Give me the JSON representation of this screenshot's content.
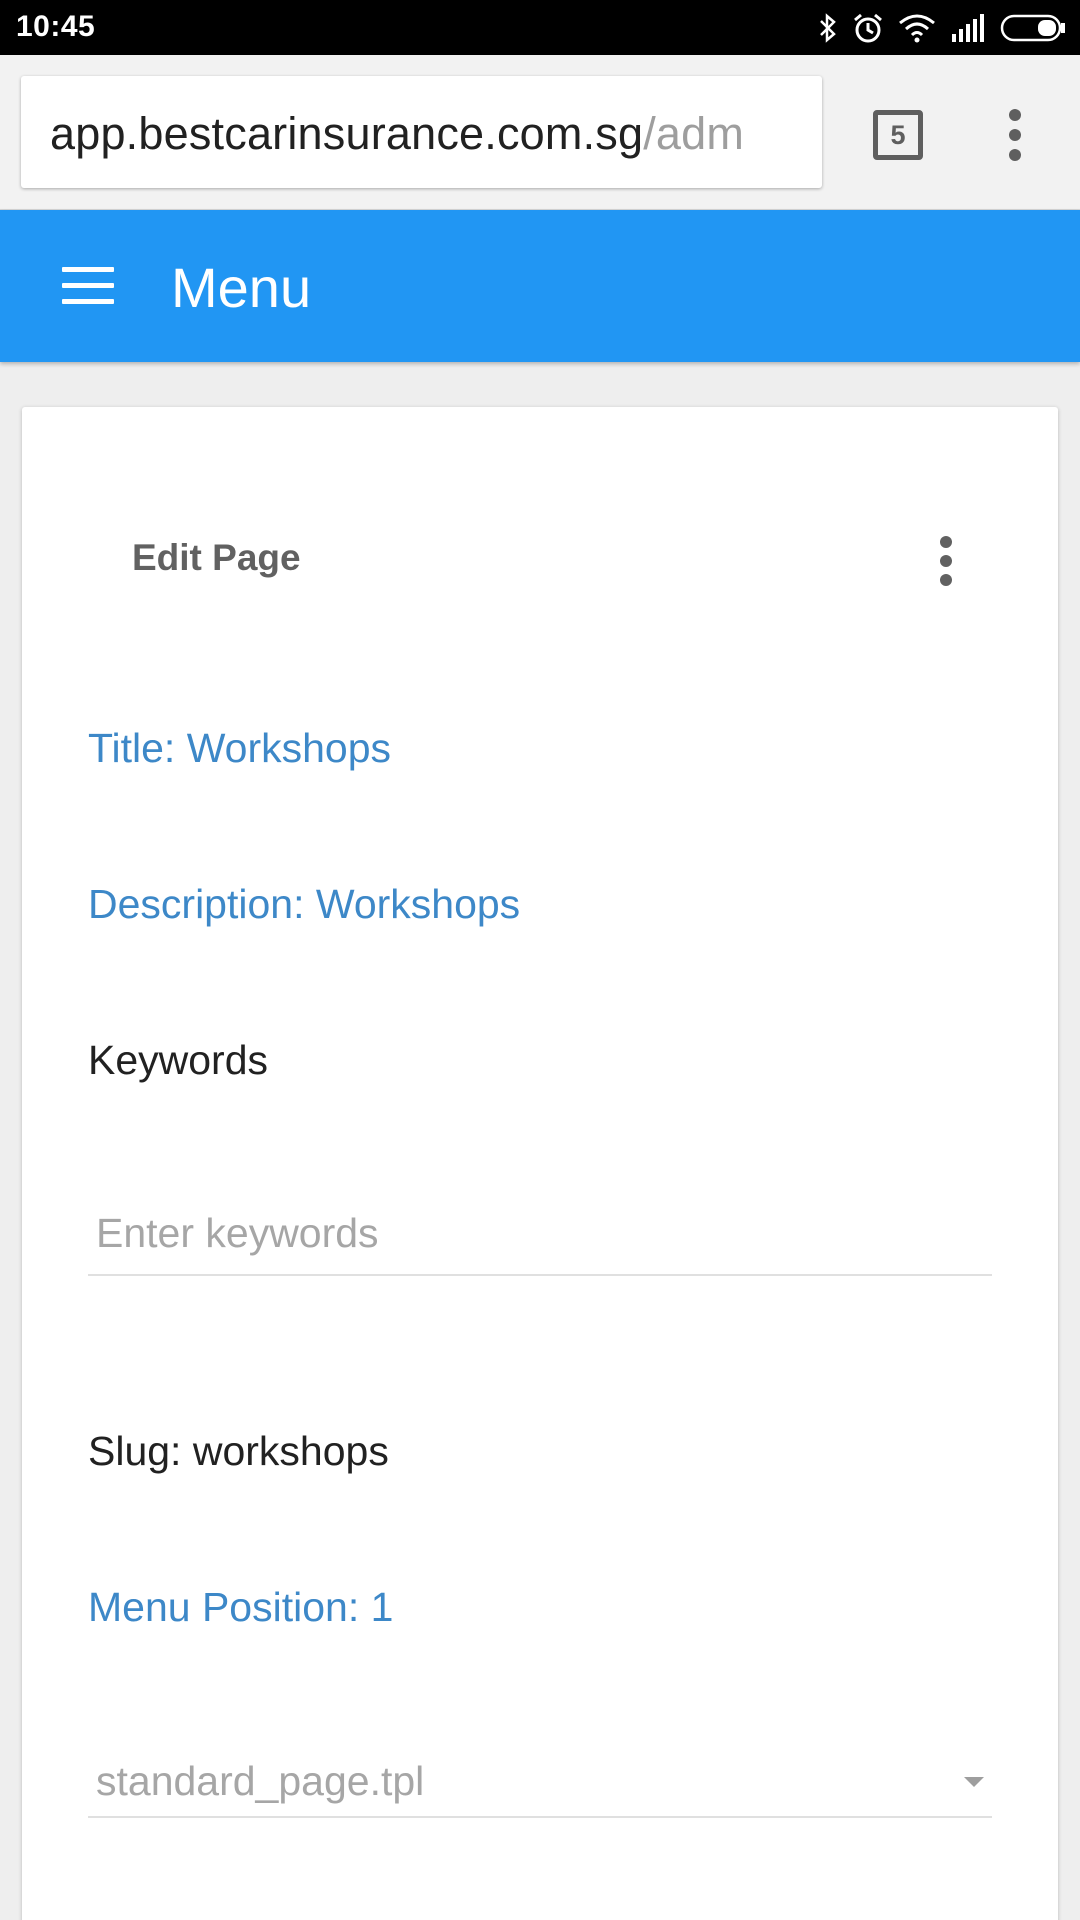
{
  "status_bar": {
    "time": "10:45",
    "icons": [
      "bluetooth-icon",
      "alarm-icon",
      "wifi-icon",
      "signal-icon",
      "battery-icon"
    ]
  },
  "browser": {
    "url_host": "app.bestcarinsurance.com.sg",
    "url_path": "/adm",
    "tab_count": "5",
    "menu_icon": "more-vert-icon"
  },
  "app_bar": {
    "menu_icon": "hamburger-icon",
    "title": "Menu",
    "color": "#2196f3"
  },
  "card": {
    "title": "Edit Page",
    "menu_icon": "more-vert-icon",
    "fields": {
      "title": "Title: Workshops",
      "description": "Description: Workshops",
      "keywords_label": "Keywords",
      "keywords_placeholder": "Enter keywords",
      "keywords_value": "",
      "slug": "Slug: workshops",
      "menu_position": "Menu Position: 1",
      "template_value": "standard_page.tpl"
    }
  },
  "colors": {
    "accent_text": "#3d88c8",
    "primary": "#2196f3"
  }
}
